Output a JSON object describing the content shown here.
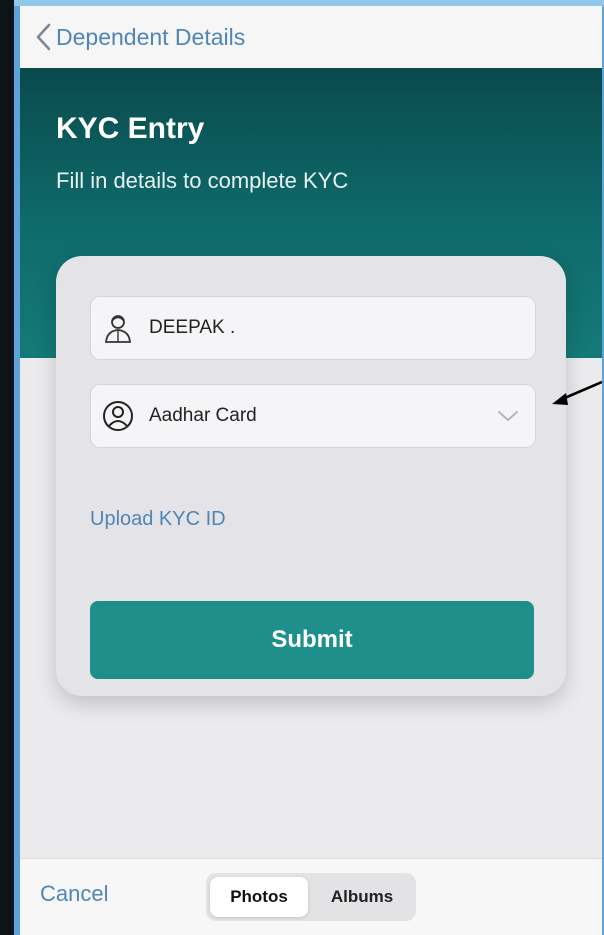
{
  "navbar": {
    "back_label": "Dependent Details"
  },
  "hero": {
    "title": "KYC Entry",
    "subtitle": "Fill in details to complete KYC"
  },
  "form": {
    "name_value": "DEEPAK .",
    "document_type": "Aadhar Card",
    "upload_link": "Upload KYC ID",
    "submit_label": "Submit"
  },
  "bottom_bar": {
    "cancel_label": "Cancel",
    "segments": [
      {
        "label": "Photos",
        "selected": true
      },
      {
        "label": "Albums",
        "selected": false
      }
    ]
  },
  "icons": {
    "back": "chevron-left-icon",
    "name_field": "user-icon",
    "document_field": "user-circle-icon",
    "dropdown": "chevron-down-icon",
    "annotation": "arrow-icon"
  },
  "colors": {
    "accent_link": "#4f86b6",
    "hero_dark": "#0a4a4d",
    "hero_light": "#147a78",
    "submit": "#1f8f8c",
    "frame_blue": "#5ba3d8"
  }
}
